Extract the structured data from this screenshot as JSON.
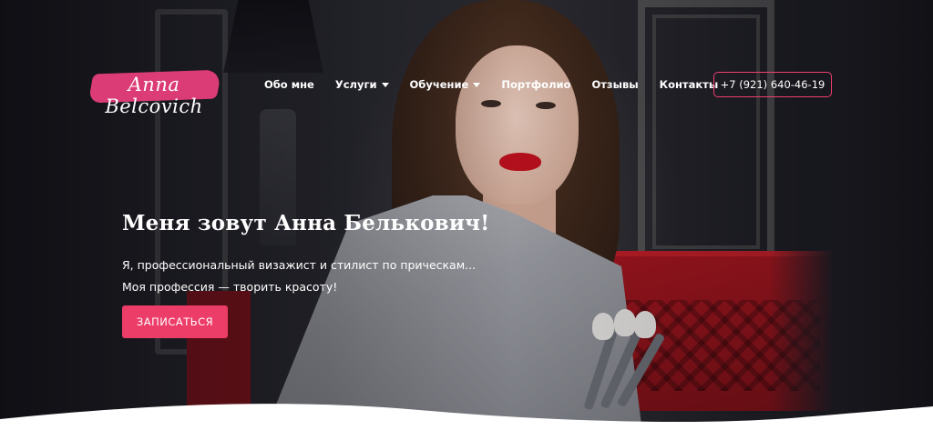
{
  "logo": {
    "text": "Anna Belcovich"
  },
  "nav": {
    "items": [
      {
        "label": "Обо мне",
        "has_dropdown": false
      },
      {
        "label": "Услуги",
        "has_dropdown": true
      },
      {
        "label": "Обучение",
        "has_dropdown": true
      },
      {
        "label": "Портфолио",
        "has_dropdown": false
      },
      {
        "label": "Отзывы",
        "has_dropdown": false
      },
      {
        "label": "Контакты",
        "has_dropdown": false
      }
    ]
  },
  "header": {
    "phone": "+7 (921) 640-46-19"
  },
  "hero": {
    "title": "Меня зовут Анна Белькович!",
    "subtitle_line1": "Я, профессиональный визажист и стилист по прическам...",
    "subtitle_line2": "Моя профессия — творить красоту!",
    "cta_label": "ЗАПИСАТЬСЯ"
  },
  "colors": {
    "accent": "#ec3d68",
    "logo_splash": "#e63e7a",
    "text": "#ffffff",
    "background": "#ffffff"
  },
  "icons": [
    "chevron-down-icon"
  ]
}
